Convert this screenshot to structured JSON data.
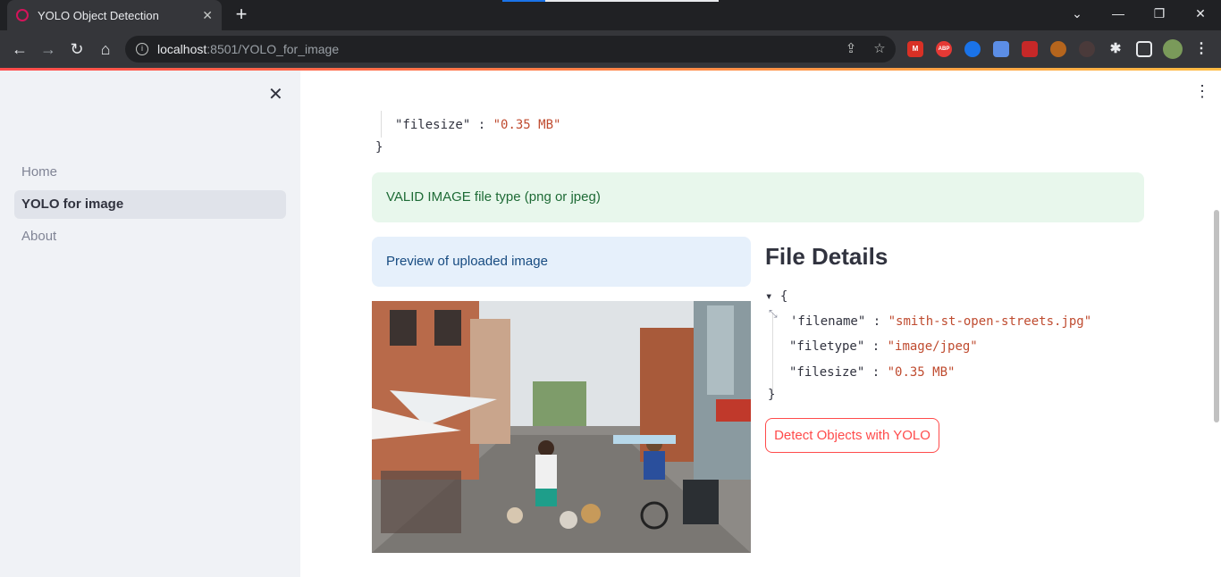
{
  "browser": {
    "tab_title": "YOLO Object Detection",
    "tab_close": "✕",
    "new_tab": "+",
    "url_host": "localhost",
    "url_path": ":8501/YOLO_for_image",
    "minimize": "—",
    "restore": "❐",
    "close": "✕",
    "tablist": "⌄",
    "extensions": [
      "M",
      "ABP",
      "",
      "",
      "",
      "",
      "",
      "",
      "",
      ""
    ]
  },
  "sidebar": {
    "close_icon": "✕",
    "items": [
      {
        "label": "Home",
        "active": false
      },
      {
        "label": "YOLO for image",
        "active": true
      },
      {
        "label": "About",
        "active": false
      }
    ]
  },
  "main": {
    "menu_icon": "⋮",
    "top_json": {
      "key": "\"filesize\"",
      "sep": " : ",
      "value": "\"0.35 MB\"",
      "close": "}"
    },
    "success_alert": "VALID IMAGE file type (png or jpeg)",
    "info_alert": "Preview of uploaded image",
    "file_details_title": "File Details",
    "file_details": {
      "open": "▾ {",
      "filename_key": "'filename\"",
      "filename_value": "\"smith-st-open-streets.jpg\"",
      "filetype_key": "\"filetype\"",
      "filetype_value": "\"image/jpeg\"",
      "filesize_key": "\"filesize\"",
      "filesize_value": "\"0.35 MB\"",
      "close": "}",
      "sep": " : "
    },
    "detect_button": "Detect Objects with YOLO"
  }
}
